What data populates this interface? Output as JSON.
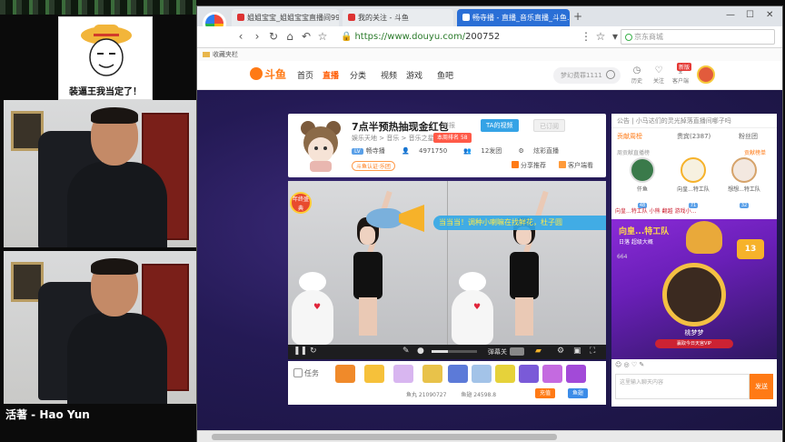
{
  "overlay": {
    "meme_caption": "装逼王我当定了！",
    "host_label": "活著 - Hao Yun"
  },
  "browser": {
    "tabs": [
      {
        "title": "姐姐宝宝_姐姐宝宝直播间9999..."
      },
      {
        "title": "我的关注 - 斗鱼"
      },
      {
        "title": "畅寺播 - 直播_音乐直播_斗鱼..."
      }
    ],
    "url_host": "https://www.douyu.com/",
    "url_path": "200752",
    "search_engine_placeholder": "京东商城",
    "bookmark_folder": "收藏夹栏"
  },
  "site": {
    "brand": "斗鱼",
    "nav": [
      "首页",
      "直播",
      "分类",
      "视频",
      "游戏",
      "鱼吧"
    ],
    "search_placeholder": "梦幻费罪1111",
    "header_icons": [
      {
        "name": "history",
        "label": "历史"
      },
      {
        "name": "follow",
        "label": "关注"
      },
      {
        "name": "client",
        "label": "客户端"
      }
    ],
    "client_badge": "新版"
  },
  "room": {
    "title": "7点半预热抽现金红包",
    "report": "举报",
    "btn_ta": "TA的视频",
    "btn_sub": "已订阅",
    "breadcrumb": "娱乐天地 > 音乐 > 音乐之星",
    "rank_badge": "本周排名",
    "level": "58",
    "anchor_name": "畅寺播",
    "popularity": "4971750",
    "fans": "12发团",
    "rank_label": "炫彩直播",
    "tag": "斗鱼认证·乐团",
    "share_label": "分享推荐",
    "client_watch_label": "客户端看",
    "ticker": "当当当！调种小喇嘛在找鲜花，杜子圆",
    "corner_badge": "年终盛典",
    "danmu_label": "弹幕关",
    "volume_level": 0.35,
    "task_label": "任务",
    "fish_balls_label": "鱼丸 21090727",
    "fish_wings_label": "鱼翅 24598.8",
    "recharge_label": "充值",
    "fish_label": "鱼翅"
  },
  "side": {
    "notice": "公告 | 小马达们的灵光掉落直播间哪子吗",
    "rank_tabs": [
      "贡献周榜",
      "贵宾(2387)",
      "粉丝团"
    ],
    "rank_title": "周贡献直播榜",
    "rank_more": "贡献榜单",
    "top3": [
      {
        "name": "仟鱼",
        "lv": "48"
      },
      {
        "name": "向皇...特工队",
        "lv": "71"
      },
      {
        "name": "想想...特工队",
        "lv": "32"
      }
    ],
    "chat_row": "向皇...特工队  小熊  翻越  游戏小…",
    "promo_title": "向皇...特工队",
    "promo_sub": "日落 超级大概",
    "promo_num": "664",
    "promo_medal": "13",
    "promo_name": "桃梦梦",
    "promo_tag": "赢取今日天宫VIP",
    "chat_tools": "☺ ◎ ♡  ✎",
    "chat_placeholder": "这里输入聊天内容",
    "send": "发送"
  },
  "colors": {
    "brand": "#ff7a15",
    "douyu_bg": "#241a55",
    "tab_active": "#2a6fd6"
  }
}
